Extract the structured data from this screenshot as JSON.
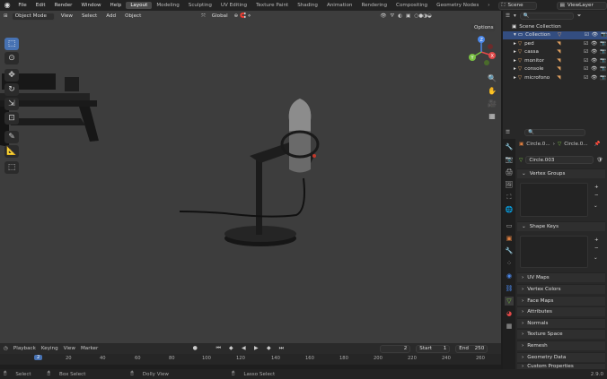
{
  "topbar": {
    "menus": [
      "File",
      "Edit",
      "Render",
      "Window",
      "Help"
    ],
    "workspaces": [
      "Layout",
      "Modeling",
      "Sculpting",
      "UV Editing",
      "Texture Paint",
      "Shading",
      "Animation",
      "Rendering",
      "Compositing",
      "Geometry Nodes"
    ],
    "active_workspace": "Layout",
    "scene": "Scene",
    "view_layer": "ViewLayer"
  },
  "viewport": {
    "mode": "Object Mode",
    "menus": [
      "View",
      "Select",
      "Add",
      "Object"
    ],
    "orientation": "Global",
    "options": "Options",
    "background": "#3d3d3d",
    "gizmo_axes": [
      "X",
      "Y",
      "Z"
    ]
  },
  "tools": [
    "cursor-select",
    "cursor",
    "move",
    "rotate",
    "scale",
    "transform",
    "annotate",
    "measure",
    "add-cube"
  ],
  "outliner": {
    "root": "Scene Collection",
    "items": [
      {
        "name": "Collection"
      },
      {
        "name": "ped"
      },
      {
        "name": "cassa"
      },
      {
        "name": "monitor"
      },
      {
        "name": "console"
      },
      {
        "name": "microfono"
      }
    ]
  },
  "properties": {
    "search_placeholder": "",
    "breadcrumb_object": "Circle.0...",
    "breadcrumb_mesh": "Circle.0...",
    "mesh_name": "Circle.003",
    "panels_open": [
      "Vertex Groups",
      "Shape Keys"
    ],
    "panels_closed": [
      "UV Maps",
      "Vertex Colors",
      "Face Maps",
      "Attributes",
      "Normals",
      "Texture Space",
      "Remesh",
      "Geometry Data",
      "Custom Properties"
    ]
  },
  "timeline": {
    "menus": [
      "Playback",
      "Keying",
      "View",
      "Marker"
    ],
    "current_frame": "2",
    "start_label": "Start",
    "start": "1",
    "end_label": "End",
    "end": "250",
    "ruler": [
      "2",
      "20",
      "40",
      "60",
      "80",
      "100",
      "120",
      "140",
      "160",
      "180",
      "200",
      "220",
      "240",
      "260"
    ]
  },
  "statusbar": {
    "items": [
      "Select",
      "Box Select",
      "Dolly View",
      "Lasso Select"
    ],
    "version": "2.9.0"
  }
}
